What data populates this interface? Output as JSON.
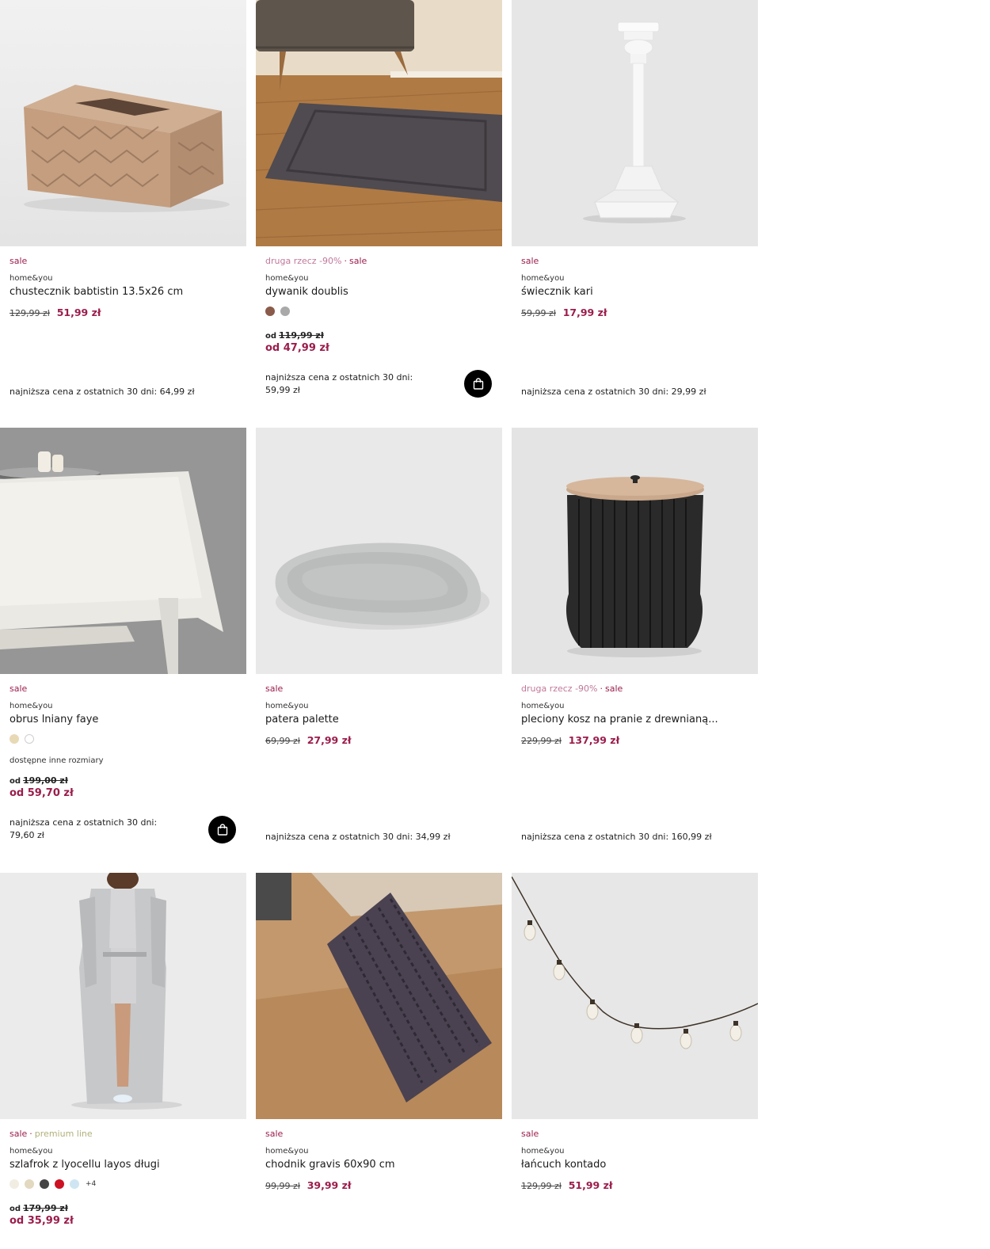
{
  "products": [
    {
      "tags": [
        "sale"
      ],
      "brand": "home&you",
      "name": "chustecznik babtistin 13.5x26 cm",
      "old_price": "129,99 zł",
      "new_price": "51,99 zł",
      "lowest": "najniższa cena z ostatnich 30 dni: 64,99 zł"
    },
    {
      "tags": [
        "druga rzecz -90%",
        "sale"
      ],
      "brand": "home&you",
      "name": "dywanik doublis",
      "colors": [
        "#8a5a4a",
        "#a9a9a9"
      ],
      "from_label": "od",
      "old_price": "119,99 zł",
      "new_price": "od 47,99 zł",
      "lowest": "najniższa cena z ostatnich 30 dni:",
      "lowest_value": "59,99 zł"
    },
    {
      "tags": [
        "sale"
      ],
      "brand": "home&you",
      "name": "świecznik kari",
      "old_price": "59,99 zł",
      "new_price": "17,99 zł",
      "lowest": "najniższa cena z ostatnich 30 dni: 29,99 zł"
    },
    {
      "tags": [
        "sale"
      ],
      "brand": "home&you",
      "name": "obrus lniany faye",
      "colors": [
        "#e8d9b5",
        "#ffffff"
      ],
      "sizes_note": "dostępne inne rozmiary",
      "from_label": "od",
      "old_price": "199,00 zł",
      "new_price": "od 59,70 zł",
      "lowest": "najniższa cena z ostatnich 30 dni:",
      "lowest_value": "79,60 zł"
    },
    {
      "tags": [
        "sale"
      ],
      "brand": "home&you",
      "name": "patera palette",
      "old_price": "69,99 zł",
      "new_price": "27,99 zł",
      "lowest": "najniższa cena z ostatnich 30 dni: 34,99 zł"
    },
    {
      "tags": [
        "druga rzecz -90%",
        "sale"
      ],
      "brand": "home&you",
      "name": "pleciony kosz na pranie z drewnianą...",
      "old_price": "229,99 zł",
      "new_price": "137,99 zł",
      "lowest": "najniższa cena z ostatnich 30 dni: 160,99 zł"
    },
    {
      "tags": [
        "sale",
        "premium line"
      ],
      "brand": "home&you",
      "name": "szlafrok z lyocellu layos długi",
      "colors": [
        "#f2ede2",
        "#e3d8c0",
        "#444444",
        "#cc1122",
        "#cfe6f2"
      ],
      "more_colors": "+4",
      "from_label": "od",
      "old_price": "179,99 zł",
      "new_price": "od 35,99 zł"
    },
    {
      "tags": [
        "sale"
      ],
      "brand": "home&you",
      "name": "chodnik gravis 60x90 cm",
      "old_price": "99,99 zł",
      "new_price": "39,99 zł"
    },
    {
      "tags": [
        "sale"
      ],
      "brand": "home&you",
      "name": "łańcuch kontado",
      "old_price": "129,99 zł",
      "new_price": "51,99 zł"
    }
  ],
  "colors": {
    "accent": "#9b1d4c",
    "promo": "#c0789a",
    "premium": "#b2b07a"
  },
  "icons": {
    "cart": "shopping-bag-icon"
  }
}
